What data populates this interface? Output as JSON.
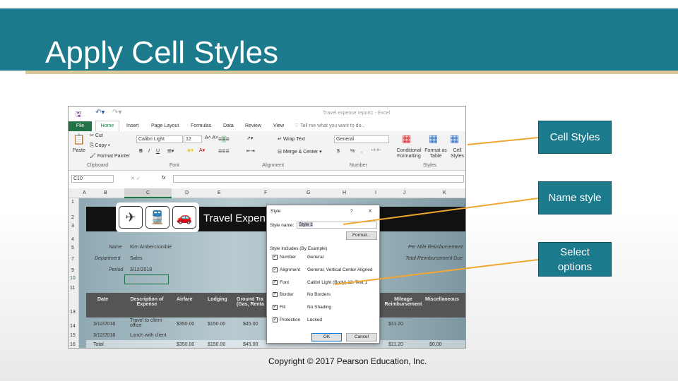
{
  "slide": {
    "title": "Apply Cell Styles",
    "copyright": "Copyright © 2017 Pearson Education, Inc.",
    "accent": "#1b7a8c"
  },
  "callouts": [
    {
      "label": "Cell Styles"
    },
    {
      "label": "Name style"
    },
    {
      "label": "Select options"
    }
  ],
  "excel": {
    "window_title": "Travel expense report1 - Excel",
    "tabs": [
      "File",
      "Home",
      "Insert",
      "Page Layout",
      "Formulas",
      "Data",
      "Review",
      "View"
    ],
    "tell_me": "Tell me what you want to do...",
    "clipboard": {
      "paste": "Paste",
      "cut": "Cut",
      "copy": "Copy",
      "format_painter": "Format Painter",
      "group": "Clipboard"
    },
    "font": {
      "name": "Calibri Light",
      "size": "12",
      "bold": "B",
      "italic": "I",
      "underline": "U",
      "group": "Font"
    },
    "alignment": {
      "wrap": "Wrap Text",
      "merge": "Merge & Center",
      "group": "Alignment"
    },
    "number": {
      "format": "General",
      "currency": "$",
      "percent": "%",
      "comma": ",",
      "group": "Number"
    },
    "styles": {
      "conditional": "Conditional Formatting",
      "format_table": "Format as Table",
      "cell_styles": "Cell Styles",
      "group": "Styles"
    },
    "name_box": "C10",
    "fx": "fx",
    "columns": [
      "A",
      "B",
      "C",
      "D",
      "E",
      "F",
      "G",
      "H",
      "I",
      "J",
      "K"
    ],
    "rows": [
      "1",
      "2",
      "3",
      "4",
      "5",
      "7",
      "9",
      "10",
      "11",
      "13",
      "14",
      "15",
      "16"
    ],
    "sheet": {
      "banner_title": "Travel Expen",
      "labels": {
        "name": "Name",
        "department": "Department",
        "period": "Period",
        "per_mile": "Per Mile Reimbursement",
        "total_due": "Total Reimbursement Due"
      },
      "values": {
        "name": "Kim Ambercrombie",
        "department": "Sales",
        "period": "3/12/2018"
      },
      "headers": [
        "Date",
        "Description of Expense",
        "Airfare",
        "Lodging",
        "Ground Tra (Gas, Renta",
        "Mileage Reimbursement",
        "Miscellaneous"
      ],
      "rows": [
        [
          "3/12/2018",
          "Travel to client office",
          "$350.00",
          "$150.00",
          "$45.00",
          "$11.20",
          ""
        ],
        [
          "3/12/2018",
          "Lunch with client",
          "",
          "",
          "",
          "",
          ""
        ],
        [
          "Total",
          "",
          "$350.00",
          "$150.00",
          "$45.00",
          "$11.20",
          "$0.00"
        ]
      ]
    },
    "dialog": {
      "title": "Style",
      "help": "?",
      "close": "X",
      "style_name_label": "Style name:",
      "style_name": "Style 1",
      "format_btn": "Format...",
      "includes": "Style Includes (By Example)",
      "options": [
        {
          "label": "Number",
          "value": "General",
          "checked": true
        },
        {
          "label": "Alignment",
          "value": "General, Vertical Center Aligned",
          "checked": true
        },
        {
          "label": "Font",
          "value": "Calibri Light (Body) 12, Text 1",
          "checked": true
        },
        {
          "label": "Border",
          "value": "No Borders",
          "checked": true
        },
        {
          "label": "Fill",
          "value": "No Shading",
          "checked": true
        },
        {
          "label": "Protection",
          "value": "Locked",
          "checked": true
        }
      ],
      "ok": "OK",
      "cancel": "Cancel"
    }
  }
}
